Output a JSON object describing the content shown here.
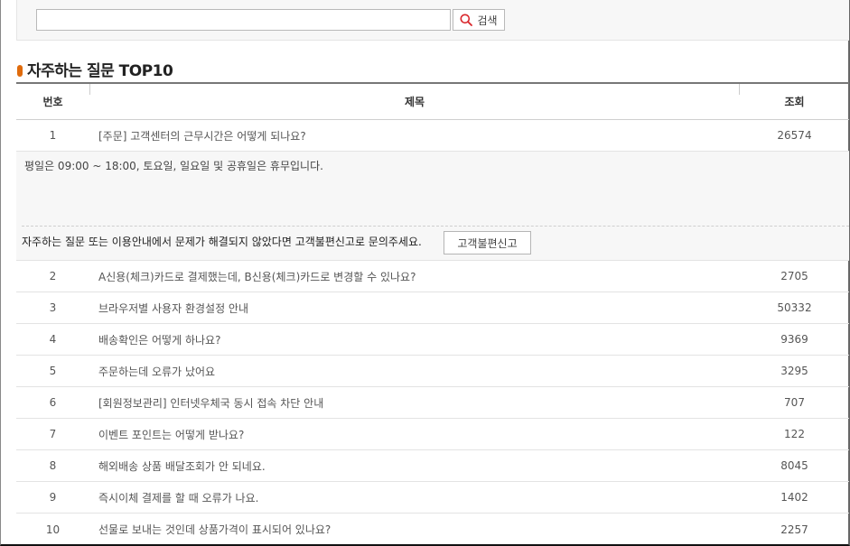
{
  "search": {
    "value": "",
    "button_label": "검색"
  },
  "section": {
    "title": "자주하는 질문 TOP10"
  },
  "table": {
    "headers": {
      "num": "번호",
      "title": "제목",
      "views": "조회"
    },
    "rows": [
      {
        "num": "1",
        "title": "[주문] 고객센터의 근무시간은 어떻게 되나요?",
        "views": "26574"
      },
      {
        "num": "2",
        "title": "A신용(체크)카드로 결제했는데, B신용(체크)카드로 변경할 수 있나요?",
        "views": "2705"
      },
      {
        "num": "3",
        "title": "브라우저별 사용자 환경설정 안내",
        "views": "50332"
      },
      {
        "num": "4",
        "title": "배송확인은 어떻게 하나요?",
        "views": "9369"
      },
      {
        "num": "5",
        "title": "주문하는데 오류가 났어요",
        "views": "3295"
      },
      {
        "num": "6",
        "title": "[회원정보관리] 인터넷우체국 동시 접속 차단 안내",
        "views": "707"
      },
      {
        "num": "7",
        "title": "이벤트 포인트는 어떻게 받나요?",
        "views": "122"
      },
      {
        "num": "8",
        "title": "해외배송 상품 배달조회가 안 되네요.",
        "views": "8045"
      },
      {
        "num": "9",
        "title": "즉시이체 결제를 할 때 오류가 나요.",
        "views": "1402"
      },
      {
        "num": "10",
        "title": "선물로 보내는 것인데 상품가격이 표시되어 있나요?",
        "views": "2257"
      }
    ]
  },
  "answer": {
    "text": "평일은 09:00 ~ 18:00, 토요일, 일요일 및 공휴일은 휴무입니다.",
    "notice": "자주하는 질문 또는 이용안내에서 문제가 해결되지 않았다면 고객불편신고로 문의주세요.",
    "report_button": "고객불편신고"
  },
  "colors": {
    "accent": "#e06b0c",
    "search_icon": "#d9262b"
  }
}
